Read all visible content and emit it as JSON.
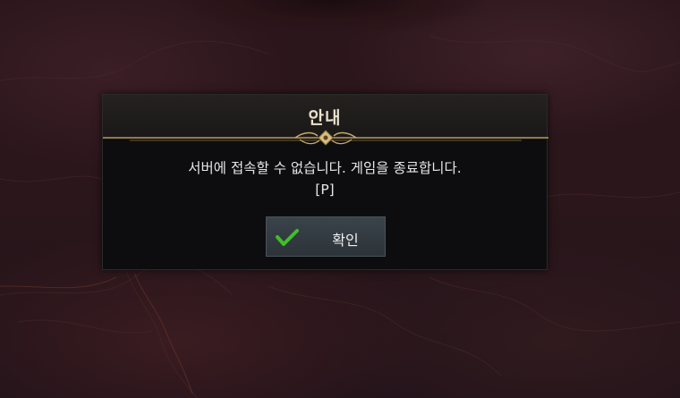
{
  "dialog": {
    "title": "안내",
    "message_line1": "서버에 접속할 수 없습니다. 게임을 종료합니다.",
    "message_line2": "[P]",
    "ok_label": "확인"
  },
  "icons": {
    "confirm": "checkmark-icon"
  },
  "colors": {
    "accent_gold": "#b89a5e",
    "check_green": "#3fbf2a",
    "button_bg": "#343b42",
    "dialog_bg": "#0d0d0f"
  }
}
